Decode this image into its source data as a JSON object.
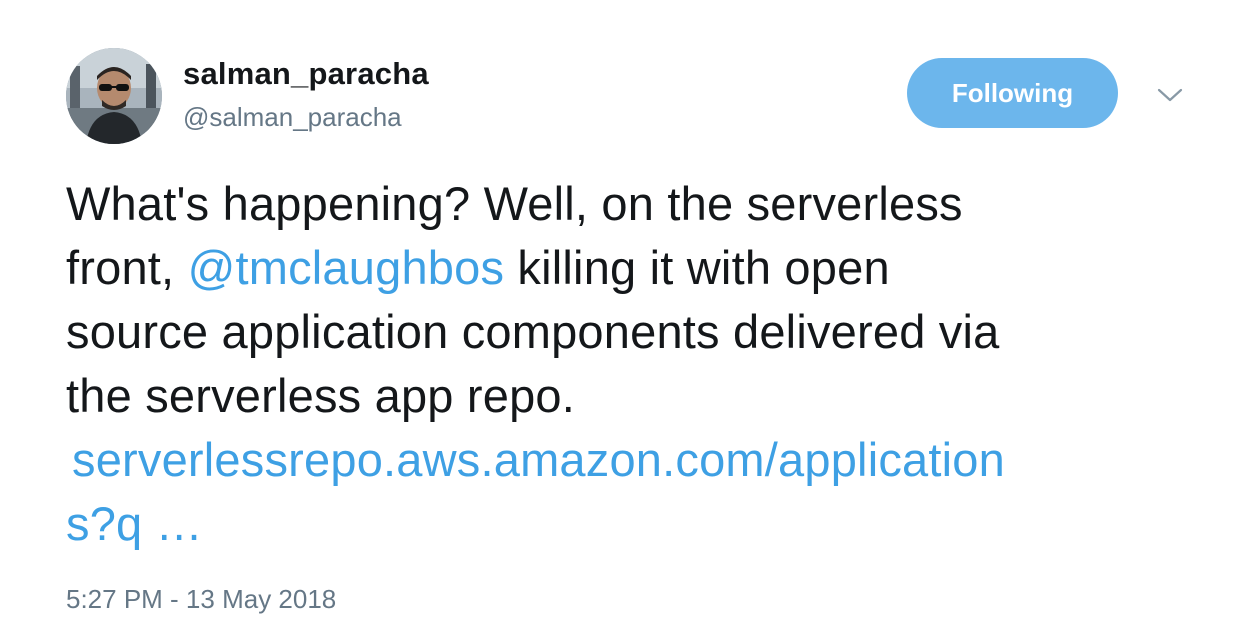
{
  "user": {
    "display_name": "salman_paracha",
    "handle": "@salman_paracha"
  },
  "follow_button": {
    "label": "Following"
  },
  "menu": {
    "icon": "chevron-down-icon"
  },
  "tweet": {
    "line1": "What's happening? Well, on the serverless",
    "line2_prefix": "front, ",
    "mention": "@tmclaughbos",
    "line2_suffix": " killing it with open",
    "line3": "source application components delivered via",
    "line4": "the serverless app repo.",
    "url_line1": "serverlessrepo.aws.amazon.com/application",
    "url_line2": "s?q …"
  },
  "timestamp": "5:27 PM - 13 May 2018",
  "colors": {
    "link": "#3ea0e4",
    "button": "#6cb6ec",
    "secondary_text": "#657786",
    "primary_text": "#14171a"
  }
}
